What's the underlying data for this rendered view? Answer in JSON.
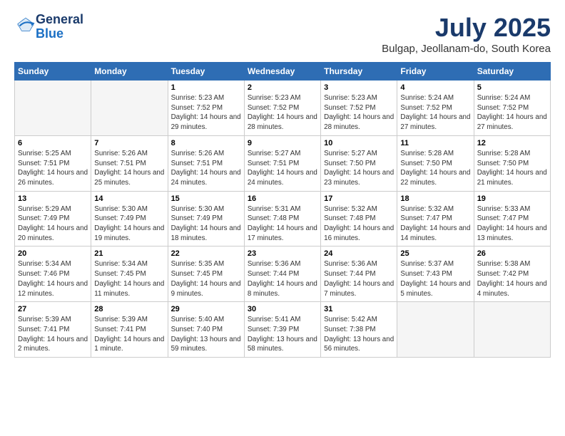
{
  "logo": {
    "general": "General",
    "blue": "Blue"
  },
  "title": {
    "month": "July 2025",
    "location": "Bulgap, Jeollanam-do, South Korea"
  },
  "weekdays": [
    "Sunday",
    "Monday",
    "Tuesday",
    "Wednesday",
    "Thursday",
    "Friday",
    "Saturday"
  ],
  "weeks": [
    [
      {
        "day": "",
        "sunrise": "",
        "sunset": "",
        "daylight": ""
      },
      {
        "day": "",
        "sunrise": "",
        "sunset": "",
        "daylight": ""
      },
      {
        "day": "1",
        "sunrise": "Sunrise: 5:23 AM",
        "sunset": "Sunset: 7:52 PM",
        "daylight": "Daylight: 14 hours and 29 minutes."
      },
      {
        "day": "2",
        "sunrise": "Sunrise: 5:23 AM",
        "sunset": "Sunset: 7:52 PM",
        "daylight": "Daylight: 14 hours and 28 minutes."
      },
      {
        "day": "3",
        "sunrise": "Sunrise: 5:23 AM",
        "sunset": "Sunset: 7:52 PM",
        "daylight": "Daylight: 14 hours and 28 minutes."
      },
      {
        "day": "4",
        "sunrise": "Sunrise: 5:24 AM",
        "sunset": "Sunset: 7:52 PM",
        "daylight": "Daylight: 14 hours and 27 minutes."
      },
      {
        "day": "5",
        "sunrise": "Sunrise: 5:24 AM",
        "sunset": "Sunset: 7:52 PM",
        "daylight": "Daylight: 14 hours and 27 minutes."
      }
    ],
    [
      {
        "day": "6",
        "sunrise": "Sunrise: 5:25 AM",
        "sunset": "Sunset: 7:51 PM",
        "daylight": "Daylight: 14 hours and 26 minutes."
      },
      {
        "day": "7",
        "sunrise": "Sunrise: 5:26 AM",
        "sunset": "Sunset: 7:51 PM",
        "daylight": "Daylight: 14 hours and 25 minutes."
      },
      {
        "day": "8",
        "sunrise": "Sunrise: 5:26 AM",
        "sunset": "Sunset: 7:51 PM",
        "daylight": "Daylight: 14 hours and 24 minutes."
      },
      {
        "day": "9",
        "sunrise": "Sunrise: 5:27 AM",
        "sunset": "Sunset: 7:51 PM",
        "daylight": "Daylight: 14 hours and 24 minutes."
      },
      {
        "day": "10",
        "sunrise": "Sunrise: 5:27 AM",
        "sunset": "Sunset: 7:50 PM",
        "daylight": "Daylight: 14 hours and 23 minutes."
      },
      {
        "day": "11",
        "sunrise": "Sunrise: 5:28 AM",
        "sunset": "Sunset: 7:50 PM",
        "daylight": "Daylight: 14 hours and 22 minutes."
      },
      {
        "day": "12",
        "sunrise": "Sunrise: 5:28 AM",
        "sunset": "Sunset: 7:50 PM",
        "daylight": "Daylight: 14 hours and 21 minutes."
      }
    ],
    [
      {
        "day": "13",
        "sunrise": "Sunrise: 5:29 AM",
        "sunset": "Sunset: 7:49 PM",
        "daylight": "Daylight: 14 hours and 20 minutes."
      },
      {
        "day": "14",
        "sunrise": "Sunrise: 5:30 AM",
        "sunset": "Sunset: 7:49 PM",
        "daylight": "Daylight: 14 hours and 19 minutes."
      },
      {
        "day": "15",
        "sunrise": "Sunrise: 5:30 AM",
        "sunset": "Sunset: 7:49 PM",
        "daylight": "Daylight: 14 hours and 18 minutes."
      },
      {
        "day": "16",
        "sunrise": "Sunrise: 5:31 AM",
        "sunset": "Sunset: 7:48 PM",
        "daylight": "Daylight: 14 hours and 17 minutes."
      },
      {
        "day": "17",
        "sunrise": "Sunrise: 5:32 AM",
        "sunset": "Sunset: 7:48 PM",
        "daylight": "Daylight: 14 hours and 16 minutes."
      },
      {
        "day": "18",
        "sunrise": "Sunrise: 5:32 AM",
        "sunset": "Sunset: 7:47 PM",
        "daylight": "Daylight: 14 hours and 14 minutes."
      },
      {
        "day": "19",
        "sunrise": "Sunrise: 5:33 AM",
        "sunset": "Sunset: 7:47 PM",
        "daylight": "Daylight: 14 hours and 13 minutes."
      }
    ],
    [
      {
        "day": "20",
        "sunrise": "Sunrise: 5:34 AM",
        "sunset": "Sunset: 7:46 PM",
        "daylight": "Daylight: 14 hours and 12 minutes."
      },
      {
        "day": "21",
        "sunrise": "Sunrise: 5:34 AM",
        "sunset": "Sunset: 7:45 PM",
        "daylight": "Daylight: 14 hours and 11 minutes."
      },
      {
        "day": "22",
        "sunrise": "Sunrise: 5:35 AM",
        "sunset": "Sunset: 7:45 PM",
        "daylight": "Daylight: 14 hours and 9 minutes."
      },
      {
        "day": "23",
        "sunrise": "Sunrise: 5:36 AM",
        "sunset": "Sunset: 7:44 PM",
        "daylight": "Daylight: 14 hours and 8 minutes."
      },
      {
        "day": "24",
        "sunrise": "Sunrise: 5:36 AM",
        "sunset": "Sunset: 7:44 PM",
        "daylight": "Daylight: 14 hours and 7 minutes."
      },
      {
        "day": "25",
        "sunrise": "Sunrise: 5:37 AM",
        "sunset": "Sunset: 7:43 PM",
        "daylight": "Daylight: 14 hours and 5 minutes."
      },
      {
        "day": "26",
        "sunrise": "Sunrise: 5:38 AM",
        "sunset": "Sunset: 7:42 PM",
        "daylight": "Daylight: 14 hours and 4 minutes."
      }
    ],
    [
      {
        "day": "27",
        "sunrise": "Sunrise: 5:39 AM",
        "sunset": "Sunset: 7:41 PM",
        "daylight": "Daylight: 14 hours and 2 minutes."
      },
      {
        "day": "28",
        "sunrise": "Sunrise: 5:39 AM",
        "sunset": "Sunset: 7:41 PM",
        "daylight": "Daylight: 14 hours and 1 minute."
      },
      {
        "day": "29",
        "sunrise": "Sunrise: 5:40 AM",
        "sunset": "Sunset: 7:40 PM",
        "daylight": "Daylight: 13 hours and 59 minutes."
      },
      {
        "day": "30",
        "sunrise": "Sunrise: 5:41 AM",
        "sunset": "Sunset: 7:39 PM",
        "daylight": "Daylight: 13 hours and 58 minutes."
      },
      {
        "day": "31",
        "sunrise": "Sunrise: 5:42 AM",
        "sunset": "Sunset: 7:38 PM",
        "daylight": "Daylight: 13 hours and 56 minutes."
      },
      {
        "day": "",
        "sunrise": "",
        "sunset": "",
        "daylight": ""
      },
      {
        "day": "",
        "sunrise": "",
        "sunset": "",
        "daylight": ""
      }
    ]
  ]
}
